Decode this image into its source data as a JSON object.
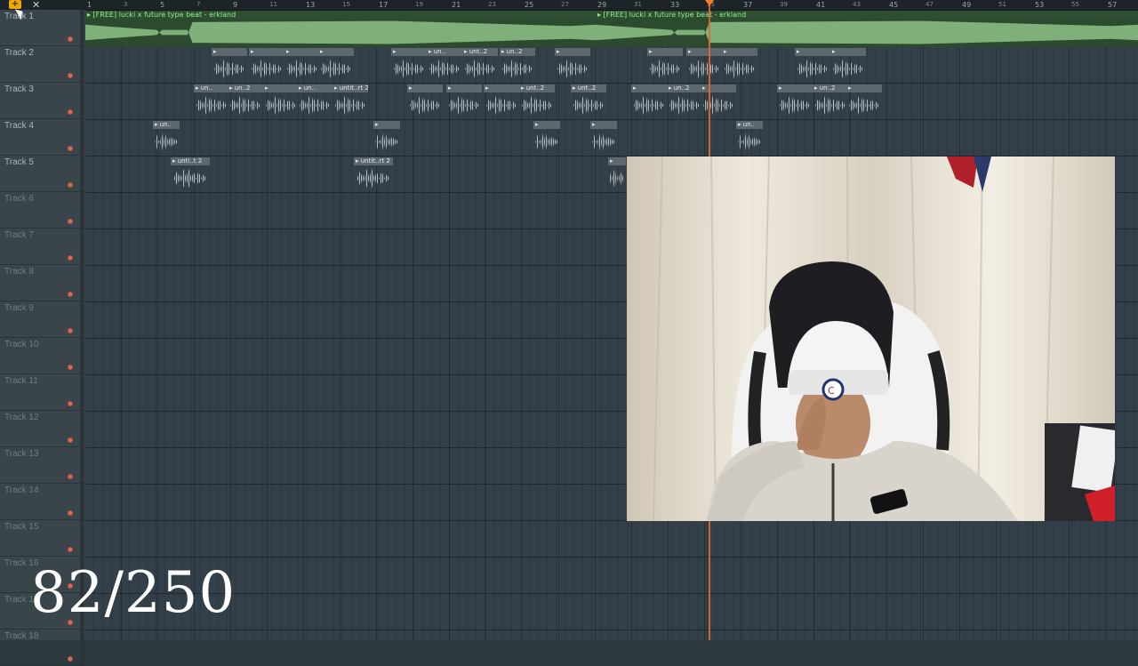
{
  "toolbar": {
    "add_icon": "plus-icon",
    "close_icon": "close-icon",
    "add_glyph": "+",
    "close_glyph": "✕"
  },
  "ruler": [
    "1",
    "3",
    "5",
    "7",
    "9",
    "11",
    "13",
    "15",
    "17",
    "19",
    "21",
    "23",
    "25",
    "27",
    "29",
    "31",
    "33",
    "35",
    "37",
    "39",
    "41",
    "43",
    "45",
    "47",
    "49",
    "51",
    "53",
    "55",
    "57"
  ],
  "tracks": [
    "Track 1",
    "Track 2",
    "Track 3",
    "Track 4",
    "Track 5",
    "Track 6",
    "Track 7",
    "Track 8",
    "Track 9",
    "Track 10",
    "Track 11",
    "Track 12",
    "Track 13",
    "Track 14",
    "Track 15",
    "Track 16",
    "Track 17",
    "Track 18"
  ],
  "track1_clips": [
    "▸ [FREE] lucki x future type beat - erkland",
    "▸ [FREE] lucki x future type beat - erkland"
  ],
  "clip_labels": {
    "t2": [
      "▸",
      "▸",
      "▸",
      "▸",
      "▸",
      "▸ un..",
      "▸ unt..2",
      "▸ un..2",
      "▸",
      "▸",
      "▸",
      "▸",
      "▸",
      "▸"
    ],
    "t3": [
      "▸ un..",
      "▸ un..2",
      "▸",
      "▸ un..",
      "▸ untit..rt 2",
      "▸",
      "▸",
      "▸",
      "▸ unt..2",
      "▸ unt..2",
      "▸",
      "▸ un..2",
      "▸",
      "▸",
      "▸ un..2",
      "▸"
    ],
    "t4": [
      "▸ un..",
      "▸",
      "▸",
      "▸",
      "▸ un.."
    ],
    "t5": [
      "▸ unti..t 2",
      "▸ untit..rt 2",
      "▸"
    ]
  },
  "counter": "82/250",
  "webcam_alt": "streamer in white beanie at desk"
}
